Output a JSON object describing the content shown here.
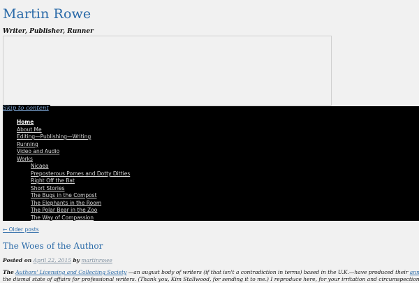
{
  "site": {
    "title": "Martin Rowe",
    "description": "Writer, Publisher, Runner"
  },
  "nav": {
    "skip_link": "Skip to content",
    "items": [
      {
        "label": "Home"
      },
      {
        "label": "About Me"
      },
      {
        "label": "Editing—Publishing—Writing"
      },
      {
        "label": "Running"
      },
      {
        "label": "Video and Audio"
      },
      {
        "label": "Works"
      }
    ],
    "sub_items": [
      {
        "label": "Nicaea"
      },
      {
        "label": "Preposterous Pomes and Dotty Ditties"
      },
      {
        "label": "Right Off the Bat"
      },
      {
        "label": "Short Stories"
      },
      {
        "label": "The Bugs in the Compost"
      },
      {
        "label": "The Elephants in the Room"
      },
      {
        "label": "The Polar Bear in the Zoo"
      },
      {
        "label": "The Way of Compassion"
      }
    ]
  },
  "pagination": {
    "older": "← Older posts"
  },
  "post": {
    "title": "The Woes of the Author",
    "posted_on": "Posted on",
    "date": "April 22, 2015",
    "by": "by",
    "author": "martinrowe",
    "excerpt": {
      "lead": "The",
      "link1": "Authors' Licensing and Collecting Society",
      "text1": "—an august body of writers (if that isn't a contradiction in terms) based in the U.K.—have produced their",
      "link2": "annual report",
      "line2": "the dismal state of affairs for professional writers. (Thank you, Kim Stallwood, for sending it to me.) I reproduce here, for your irritation and circumspection, the salient"
    }
  }
}
